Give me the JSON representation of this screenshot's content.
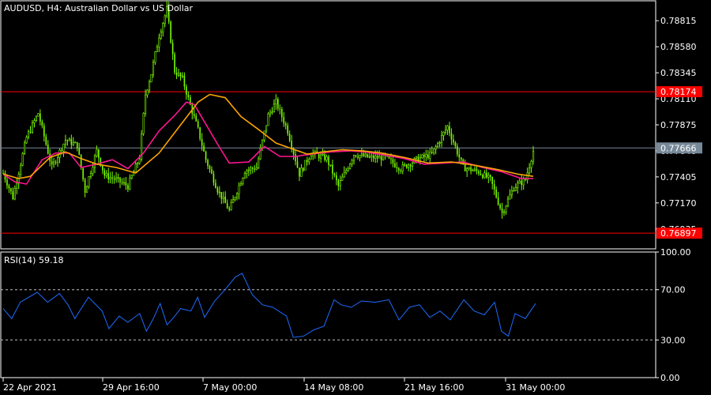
{
  "main_panel": {
    "title": "AUDUSD, H4:  Australian Dollar vs US Dollar"
  },
  "rsi_panel": {
    "title": "RSI(14) 59.18"
  },
  "colors": {
    "background": "#000000",
    "frame": "#ffffff",
    "candle": "#7cfc00",
    "ma_fast": "#ff1493",
    "ma_slow": "#ffa500",
    "hline": "#ff0000",
    "price_line": "#778899",
    "rsi": "#1e6bff",
    "level_grid": "#c0c0c0"
  },
  "chart_data": [
    {
      "type": "candlestick",
      "title": "AUDUSD, H4:  Australian Dollar vs US Dollar",
      "y_ticks": [
        0.78815,
        0.7858,
        0.78345,
        0.7811,
        0.77875,
        0.7764,
        0.77405,
        0.7717,
        0.76935
      ],
      "y_tick_labels": [
        "0.78815",
        "0.78580",
        "0.78345",
        "0.78110",
        "0.77875",
        "0.77640",
        "0.77405",
        "0.77170",
        "0.76935"
      ],
      "ylim": [
        0.76755,
        0.78995
      ],
      "x_tick_labels": [
        "22 Apr 2021",
        "29 Apr 16:00",
        "7 May 00:00",
        "14 May 08:00",
        "21 May 16:00",
        "31 May 00:00"
      ],
      "horizontal_lines": [
        {
          "value": 0.78174,
          "label": "0.78174",
          "color": "#ff0000"
        },
        {
          "value": 0.76897,
          "label": "0.76897",
          "color": "#ff0000"
        }
      ],
      "current_price": {
        "value": 0.77666,
        "label": "0.77666"
      },
      "series": [
        {
          "type": "candlestick",
          "trend": [
            [
              0,
              0.7744
            ],
            [
              5,
              0.7722
            ],
            [
              12,
              0.7776
            ],
            [
              18,
              0.7798
            ],
            [
              25,
              0.7749
            ],
            [
              32,
              0.7774
            ],
            [
              38,
              0.7769
            ],
            [
              42,
              0.7728
            ],
            [
              48,
              0.7764
            ],
            [
              52,
              0.7742
            ],
            [
              58,
              0.7738
            ],
            [
              64,
              0.7732
            ],
            [
              70,
              0.7758
            ],
            [
              73,
              0.7815
            ],
            [
              76,
              0.7834
            ],
            [
              80,
              0.7868
            ],
            [
              84,
              0.7892
            ],
            [
              88,
              0.7836
            ],
            [
              92,
              0.7829
            ],
            [
              96,
              0.7805
            ],
            [
              100,
              0.7783
            ],
            [
              104,
              0.7756
            ],
            [
              110,
              0.7729
            ],
            [
              116,
              0.771
            ],
            [
              124,
              0.7746
            ],
            [
              130,
              0.7749
            ],
            [
              136,
              0.7796
            ],
            [
              140,
              0.7808
            ],
            [
              146,
              0.7782
            ],
            [
              152,
              0.7743
            ],
            [
              158,
              0.7762
            ],
            [
              166,
              0.7757
            ],
            [
              172,
              0.7732
            ],
            [
              180,
              0.7761
            ],
            [
              188,
              0.7758
            ],
            [
              196,
              0.7758
            ],
            [
              204,
              0.7748
            ],
            [
              212,
              0.7756
            ],
            [
              220,
              0.7761
            ],
            [
              228,
              0.7786
            ],
            [
              236,
              0.7749
            ],
            [
              244,
              0.7745
            ],
            [
              250,
              0.7738
            ],
            [
              256,
              0.7708
            ],
            [
              262,
              0.7731
            ],
            [
              268,
              0.7738
            ],
            [
              272,
              0.7764
            ]
          ]
        },
        {
          "name": "",
          "type": "line",
          "color": "#ff1493",
          "values": [
            [
              0,
              0.7743
            ],
            [
              6,
              0.7736
            ],
            [
              12,
              0.7734
            ],
            [
              20,
              0.7756
            ],
            [
              27,
              0.7762
            ],
            [
              34,
              0.7762
            ],
            [
              40,
              0.7749
            ],
            [
              48,
              0.7752
            ],
            [
              56,
              0.7756
            ],
            [
              64,
              0.7748
            ],
            [
              72,
              0.7762
            ],
            [
              80,
              0.7782
            ],
            [
              88,
              0.7796
            ],
            [
              94,
              0.7808
            ],
            [
              98,
              0.7806
            ],
            [
              104,
              0.7788
            ],
            [
              110,
              0.777
            ],
            [
              116,
              0.7753
            ],
            [
              126,
              0.7754
            ],
            [
              134,
              0.7768
            ],
            [
              142,
              0.7759
            ],
            [
              150,
              0.7759
            ],
            [
              158,
              0.7761
            ],
            [
              168,
              0.7763
            ],
            [
              178,
              0.7764
            ],
            [
              186,
              0.7763
            ],
            [
              196,
              0.776
            ],
            [
              206,
              0.7757
            ],
            [
              216,
              0.7752
            ],
            [
              226,
              0.7753
            ],
            [
              236,
              0.7754
            ],
            [
              246,
              0.7749
            ],
            [
              256,
              0.7745
            ],
            [
              266,
              0.7739
            ],
            [
              272,
              0.7739
            ]
          ]
        },
        {
          "name": "",
          "type": "line",
          "color": "#ffa500",
          "values": [
            [
              0,
              0.7743
            ],
            [
              8,
              0.7739
            ],
            [
              14,
              0.7741
            ],
            [
              24,
              0.7758
            ],
            [
              32,
              0.7763
            ],
            [
              40,
              0.7757
            ],
            [
              48,
              0.7752
            ],
            [
              58,
              0.7749
            ],
            [
              68,
              0.7744
            ],
            [
              80,
              0.7762
            ],
            [
              90,
              0.7785
            ],
            [
              100,
              0.7808
            ],
            [
              106,
              0.7815
            ],
            [
              114,
              0.7812
            ],
            [
              122,
              0.7795
            ],
            [
              132,
              0.7782
            ],
            [
              140,
              0.7771
            ],
            [
              148,
              0.7766
            ],
            [
              156,
              0.7761
            ],
            [
              164,
              0.7763
            ],
            [
              174,
              0.7765
            ],
            [
              184,
              0.7764
            ],
            [
              194,
              0.7762
            ],
            [
              206,
              0.7758
            ],
            [
              218,
              0.7753
            ],
            [
              230,
              0.7754
            ],
            [
              242,
              0.7751
            ],
            [
              254,
              0.7747
            ],
            [
              264,
              0.7743
            ],
            [
              272,
              0.7741
            ]
          ]
        }
      ]
    },
    {
      "type": "line",
      "title": "RSI(14) 59.18",
      "ylim": [
        0,
        100
      ],
      "y_ticks": [
        100,
        70,
        30,
        0
      ],
      "y_tick_labels": [
        "100.00",
        "70.00",
        "30.00",
        "0.00"
      ],
      "level_lines": [
        70,
        30
      ],
      "series": [
        {
          "name": "",
          "color": "#1e6bff",
          "values": [
            [
              0,
              55
            ],
            [
              5,
              47
            ],
            [
              10,
              60
            ],
            [
              20,
              68
            ],
            [
              26,
              60
            ],
            [
              33,
              67
            ],
            [
              38,
              58
            ],
            [
              42,
              47
            ],
            [
              50,
              64
            ],
            [
              58,
              53
            ],
            [
              62,
              39
            ],
            [
              68,
              49
            ],
            [
              73,
              44
            ],
            [
              80,
              51
            ],
            [
              84,
              37
            ],
            [
              88,
              47
            ],
            [
              92,
              59
            ],
            [
              96,
              42
            ],
            [
              100,
              48
            ],
            [
              104,
              55
            ],
            [
              110,
              53
            ],
            [
              114,
              64
            ],
            [
              118,
              48
            ],
            [
              124,
              61
            ],
            [
              130,
              70
            ],
            [
              136,
              80
            ],
            [
              140,
              83
            ],
            [
              146,
              66
            ],
            [
              152,
              58
            ],
            [
              158,
              56
            ],
            [
              166,
              49
            ],
            [
              170,
              32
            ],
            [
              176,
              33
            ],
            [
              182,
              38
            ],
            [
              188,
              41
            ],
            [
              194,
              62
            ],
            [
              198,
              58
            ],
            [
              204,
              56
            ],
            [
              210,
              61
            ],
            [
              218,
              60
            ],
            [
              226,
              62
            ],
            [
              232,
              46
            ],
            [
              238,
              56
            ],
            [
              244,
              58
            ],
            [
              250,
              48
            ],
            [
              256,
              53
            ],
            [
              262,
              46
            ],
            [
              270,
              62
            ],
            [
              276,
              53
            ],
            [
              282,
              50
            ],
            [
              288,
              60
            ],
            [
              292,
              37
            ],
            [
              296,
              33
            ],
            [
              300,
              51
            ],
            [
              306,
              47
            ],
            [
              312,
              59
            ]
          ]
        }
      ]
    }
  ]
}
